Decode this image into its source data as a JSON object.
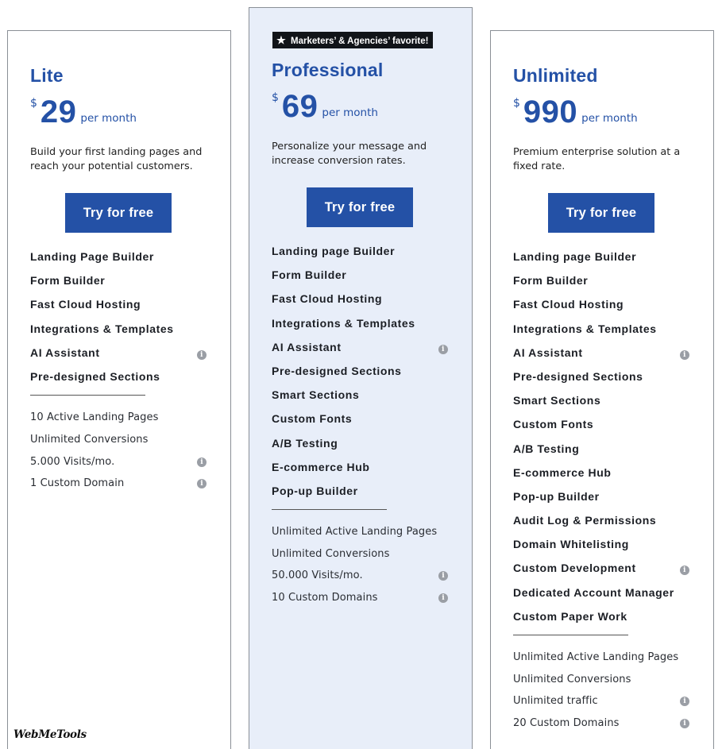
{
  "plans": {
    "lite": {
      "name": "Lite",
      "currency": "$",
      "price": "29",
      "period": "per month",
      "description": "Build your first landing pages and reach your potential customers.",
      "cta": "Try for free",
      "features": [
        {
          "label": "Landing Page Builder",
          "info": false
        },
        {
          "label": "Form Builder",
          "info": false
        },
        {
          "label": "Fast Cloud Hosting",
          "info": false
        },
        {
          "label": "Integrations & Templates",
          "info": false
        },
        {
          "label": "AI Assistant",
          "info": true
        },
        {
          "label": "Pre-designed Sections",
          "info": false
        }
      ],
      "limits": [
        {
          "label": "10 Active Landing Pages",
          "info": false
        },
        {
          "label": "Unlimited Conversions",
          "info": false
        },
        {
          "label": "5.000 Visits/mo.",
          "info": true
        },
        {
          "label": "1 Custom Domain",
          "info": true
        }
      ]
    },
    "professional": {
      "badge": "Marketers’ & Agencies’ favorite!",
      "name": "Professional",
      "currency": "$",
      "price": "69",
      "period": "per month",
      "description": "Personalize your message and increase conversion rates.",
      "cta": "Try for free",
      "features": [
        {
          "label": "Landing page Builder",
          "info": false
        },
        {
          "label": "Form Builder",
          "info": false
        },
        {
          "label": "Fast Cloud Hosting",
          "info": false
        },
        {
          "label": "Integrations & Templates",
          "info": false
        },
        {
          "label": "AI Assistant",
          "info": true
        },
        {
          "label": "Pre-designed Sections",
          "info": false
        },
        {
          "label": "Smart Sections",
          "info": false
        },
        {
          "label": "Custom Fonts",
          "info": false
        },
        {
          "label": "A/B Testing",
          "info": false
        },
        {
          "label": "E-commerce Hub",
          "info": false
        },
        {
          "label": "Pop-up Builder",
          "info": false
        }
      ],
      "limits": [
        {
          "label": "Unlimited Active Landing Pages",
          "info": false
        },
        {
          "label": "Unlimited Conversions",
          "info": false
        },
        {
          "label": "50.000 Visits/mo.",
          "info": true
        },
        {
          "label": "10 Custom Domains",
          "info": true
        }
      ]
    },
    "unlimited": {
      "name": "Unlimited",
      "currency": "$",
      "price": "990",
      "period": "per month",
      "description": "Premium enterprise solution at a fixed rate.",
      "cta": "Try for free",
      "features": [
        {
          "label": "Landing page Builder",
          "info": false
        },
        {
          "label": "Form Builder",
          "info": false
        },
        {
          "label": "Fast Cloud Hosting",
          "info": false
        },
        {
          "label": "Integrations & Templates",
          "info": false
        },
        {
          "label": "AI Assistant",
          "info": true
        },
        {
          "label": "Pre-designed Sections",
          "info": false
        },
        {
          "label": "Smart Sections",
          "info": false
        },
        {
          "label": "Custom Fonts",
          "info": false
        },
        {
          "label": "A/B Testing",
          "info": false
        },
        {
          "label": "E-commerce Hub",
          "info": false
        },
        {
          "label": "Pop-up Builder",
          "info": false
        },
        {
          "label": "Audit Log & Permissions",
          "info": false
        },
        {
          "label": "Domain Whitelisting",
          "info": false
        },
        {
          "label": "Custom Development",
          "info": true
        },
        {
          "label": "Dedicated Account Manager",
          "info": false
        },
        {
          "label": "Custom Paper Work",
          "info": false
        }
      ],
      "limits": [
        {
          "label": "Unlimited Active Landing Pages",
          "info": false
        },
        {
          "label": "Unlimited Conversions",
          "info": false
        },
        {
          "label": "Unlimited traffic",
          "info": true
        },
        {
          "label": "20 Custom Domains",
          "info": true
        }
      ]
    }
  },
  "watermark": "WebMeTools",
  "icons": {
    "info": "info-icon",
    "badge": "star-icon"
  },
  "colors": {
    "brand": "#2451a6",
    "featured_bg": "#e8eef9",
    "badge_bg": "#111418"
  }
}
